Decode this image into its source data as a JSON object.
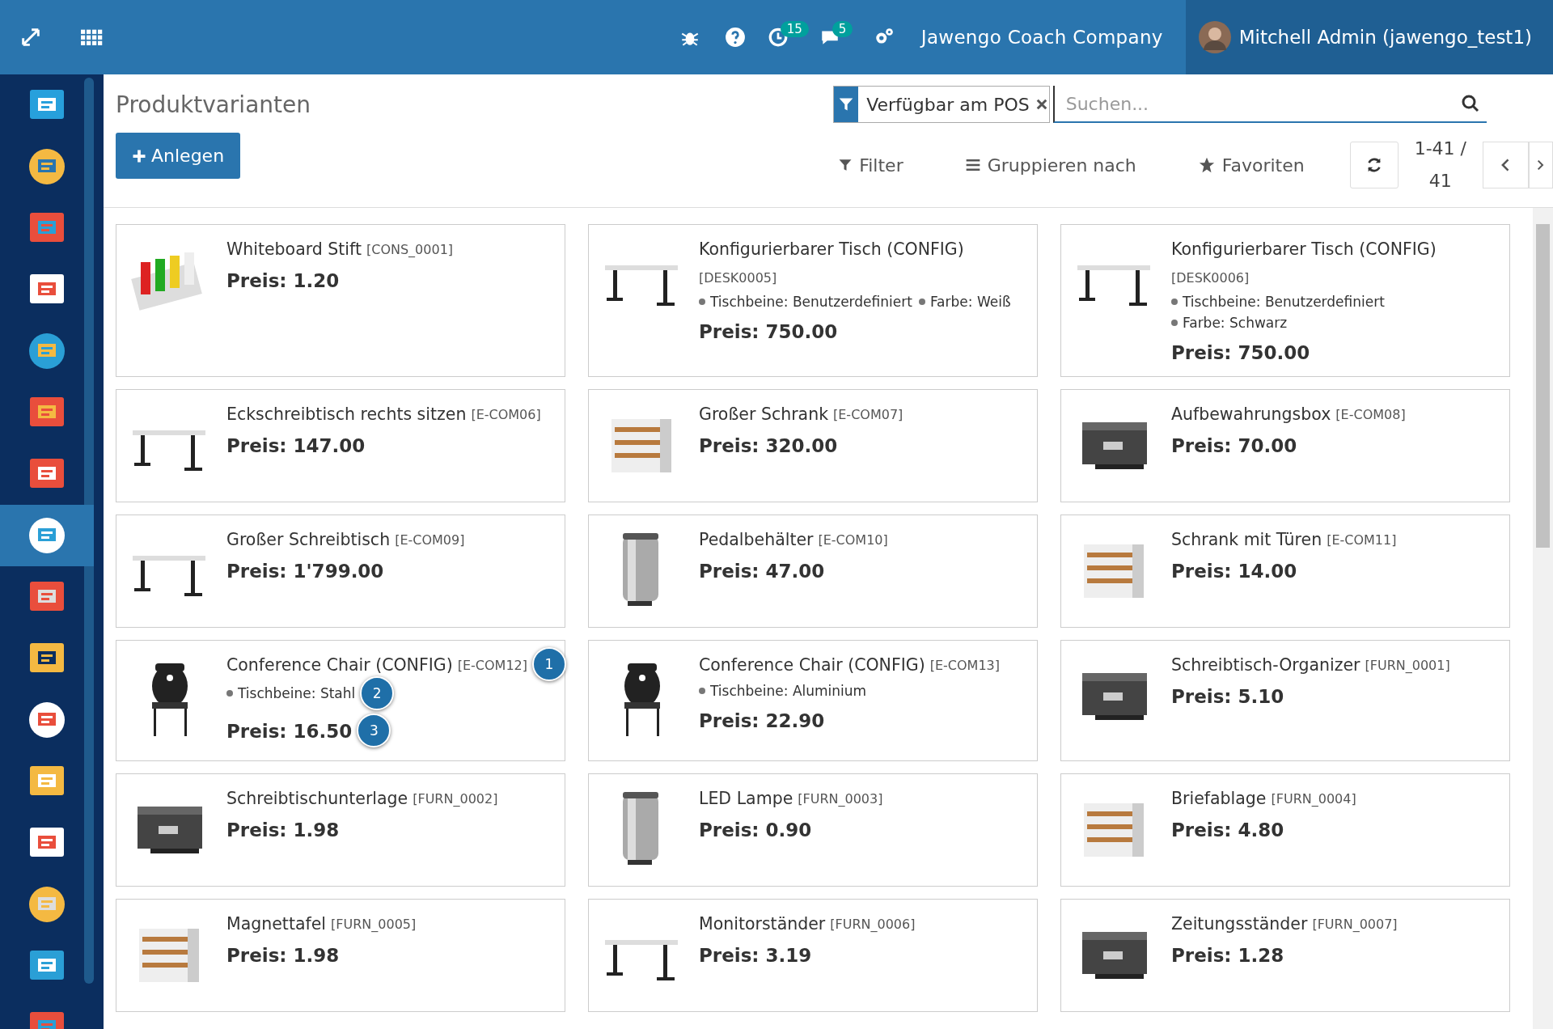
{
  "topbar": {
    "activity_badge": "15",
    "message_badge": "5",
    "company": "Jawengo Coach Company",
    "user": "Mitchell Admin (jawengo_test1)"
  },
  "sidebar": {
    "apps": [
      {
        "selected": false
      },
      {
        "selected": false
      },
      {
        "selected": false
      },
      {
        "selected": false
      },
      {
        "selected": false
      },
      {
        "selected": false
      },
      {
        "selected": false
      },
      {
        "selected": true
      },
      {
        "selected": false
      },
      {
        "selected": false
      },
      {
        "selected": false
      },
      {
        "selected": false
      },
      {
        "selected": false
      },
      {
        "selected": false
      },
      {
        "selected": false
      },
      {
        "selected": false
      }
    ]
  },
  "control_panel": {
    "title": "Produktvarianten",
    "create_button": "Anlegen",
    "facet": "Verfügbar am POS",
    "search": {
      "placeholder": "Suchen..."
    },
    "filter": "Filter",
    "group_by": "Gruppieren nach",
    "favorites": "Favoriten",
    "pager_range": "1-41 /",
    "pager_total": "41"
  },
  "cards": [
    {
      "name": "Whiteboard Stift",
      "ref": "[CONS_0001]",
      "price": "Preis: 1.20"
    },
    {
      "name": "Konfigurierbarer Tisch (CONFIG)",
      "ref": "[DESK0005]",
      "ref_on_new_line": true,
      "attributes": [
        {
          "text": "Tischbeine: Benutzerdefiniert"
        },
        {
          "text": "Farbe: Weiß"
        }
      ],
      "attributes_inline": true,
      "price": "Preis: 750.00"
    },
    {
      "name": "Konfigurierbarer Tisch (CONFIG)",
      "ref": "[DESK0006]",
      "ref_on_new_line": true,
      "attributes": [
        {
          "text": "Tischbeine: Benutzerdefiniert"
        },
        {
          "text": "Farbe: Schwarz"
        }
      ],
      "price": "Preis: 750.00"
    },
    {
      "name": "Eckschreibtisch rechts sitzen",
      "ref": "[E-COM06]",
      "price": "Preis: 147.00"
    },
    {
      "name": "Großer Schrank",
      "ref": "[E-COM07]",
      "price": "Preis: 320.00"
    },
    {
      "name": "Aufbewahrungsbox",
      "ref": "[E-COM08]",
      "price": "Preis: 70.00"
    },
    {
      "name": "Großer Schreibtisch",
      "ref": "[E-COM09]",
      "price": "Preis: 1'799.00"
    },
    {
      "name": "Pedalbehälter",
      "ref": "[E-COM10]",
      "price": "Preis: 47.00"
    },
    {
      "name": "Schrank mit Türen",
      "ref": "[E-COM11]",
      "price": "Preis: 14.00"
    },
    {
      "name": "Conference Chair (CONFIG)",
      "ref": "[E-COM12]",
      "name_marker": "1",
      "attributes": [
        {
          "text": "Tischbeine: Stahl",
          "marker": "2"
        }
      ],
      "price": "Preis: 16.50",
      "price_marker": "3"
    },
    {
      "name": "Conference Chair (CONFIG)",
      "ref": "[E-COM13]",
      "attributes": [
        {
          "text": "Tischbeine: Aluminium"
        }
      ],
      "price": "Preis: 22.90"
    },
    {
      "name": "Schreibtisch-Organizer",
      "ref": "[FURN_0001]",
      "price": "Preis: 5.10"
    },
    {
      "name": "Schreibtischunterlage",
      "ref": "[FURN_0002]",
      "price": "Preis: 1.98"
    },
    {
      "name": "LED Lampe",
      "ref": "[FURN_0003]",
      "price": "Preis: 0.90"
    },
    {
      "name": "Briefablage",
      "ref": "[FURN_0004]",
      "price": "Preis: 4.80"
    },
    {
      "name": "Magnettafel",
      "ref": "[FURN_0005]",
      "price": "Preis: 1.98"
    },
    {
      "name": "Monitorständer",
      "ref": "[FURN_0006]",
      "price": "Preis: 3.19"
    },
    {
      "name": "Zeitungsständer",
      "ref": "[FURN_0007]",
      "price": "Preis: 1.28"
    }
  ]
}
